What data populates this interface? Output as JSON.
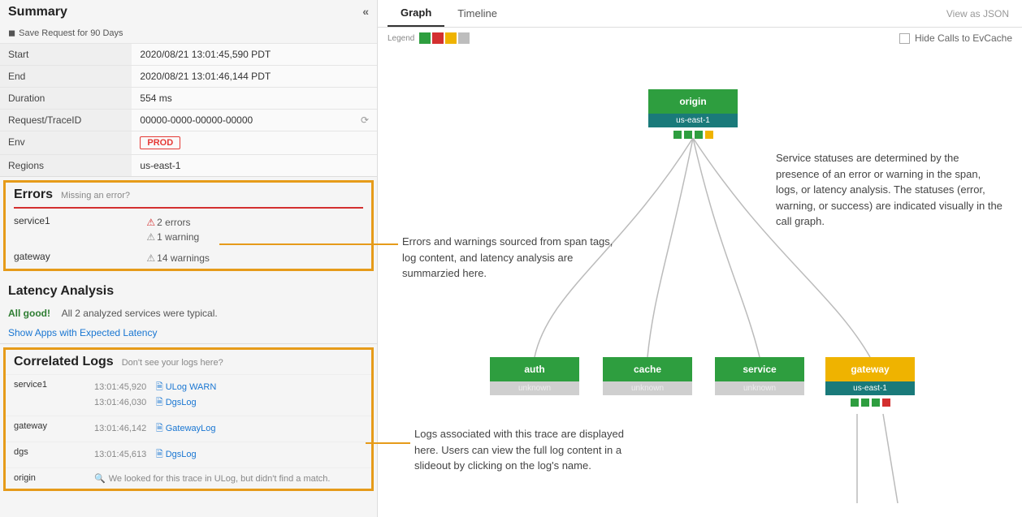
{
  "summary": {
    "title": "Summary",
    "save_label": "Save Request for 90 Days",
    "rows": {
      "start_k": "Start",
      "start_v": "2020/08/21 13:01:45,590 PDT",
      "end_k": "End",
      "end_v": "2020/08/21 13:01:46,144 PDT",
      "duration_k": "Duration",
      "duration_v": "554 ms",
      "trace_k": "Request/TraceID",
      "trace_v": "00000-0000-00000-00000",
      "env_k": "Env",
      "env_badge": "PROD",
      "regions_k": "Regions",
      "regions_v": "us-east-1"
    }
  },
  "errors": {
    "title": "Errors",
    "sub": "Missing an error?",
    "rows": [
      {
        "svc": "service1",
        "err": "2 errors",
        "warn": "1 warning"
      },
      {
        "svc": "gateway",
        "warn": "14 warnings"
      }
    ],
    "annotation": "Errors and warnings sourced from span tags, log content, and latency analysis are summarzied here."
  },
  "latency": {
    "title": "Latency Analysis",
    "good": "All good!",
    "msg": "All 2 analyzed services were typical.",
    "link": "Show Apps with Expected Latency"
  },
  "logs": {
    "title": "Correlated Logs",
    "sub": "Don't see your logs here?",
    "rows": [
      {
        "svc": "service1",
        "entries": [
          {
            "ts": "13:01:45,920",
            "name": "ULog WARN"
          },
          {
            "ts": "13:01:46,030",
            "name": "DgsLog"
          }
        ]
      },
      {
        "svc": "gateway",
        "entries": [
          {
            "ts": "13:01:46,142",
            "name": "GatewayLog"
          }
        ]
      },
      {
        "svc": "dgs",
        "entries": [
          {
            "ts": "13:01:45,613",
            "name": "DgsLog"
          }
        ]
      },
      {
        "svc": "origin",
        "notfound": "We looked for this trace in ULog, but didn't find a match."
      }
    ],
    "annotation": "Logs associated with this trace are displayed here. Users can view the full log content in a slideout by clicking on the log's name."
  },
  "tabs": {
    "graph": "Graph",
    "timeline": "Timeline",
    "view_json": "View as JSON"
  },
  "legend": {
    "label": "Legend",
    "hide": "Hide Calls to EvCache"
  },
  "graph": {
    "annotation": "Service statuses are determined by the presence of an error or warning in the span, logs, or latency analysis. The statuses (error, warning, or success) are indicated visually in the call graph.",
    "nodes": {
      "origin": {
        "title": "origin",
        "region": "us-east-1",
        "title_bg": "#2e9e3f",
        "region_bg": "#1a7a7a",
        "dots": [
          "green",
          "green",
          "green",
          "orange"
        ]
      },
      "auth": {
        "title": "auth",
        "region": "unknown",
        "title_bg": "#2e9e3f",
        "region_bg": "#cfcfcf"
      },
      "cache": {
        "title": "cache",
        "region": "unknown",
        "title_bg": "#2e9e3f",
        "region_bg": "#cfcfcf"
      },
      "service": {
        "title": "service",
        "region": "unknown",
        "title_bg": "#2e9e3f",
        "region_bg": "#cfcfcf"
      },
      "gateway": {
        "title": "gateway",
        "region": "us-east-1",
        "title_bg": "#efb300",
        "region_bg": "#1a7a7a",
        "dots": [
          "green",
          "green",
          "green",
          "red"
        ]
      }
    }
  }
}
